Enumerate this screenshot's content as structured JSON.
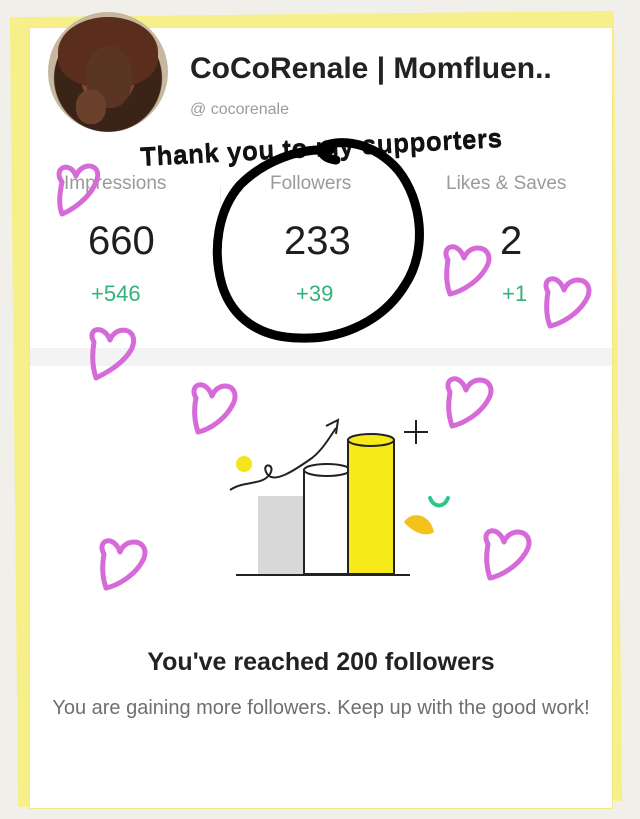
{
  "profile": {
    "name": "CoCoRenale | Momfluen..",
    "handle": "@ cocorenale"
  },
  "annotation": {
    "thanks": "Thank you to my supporters"
  },
  "stats": [
    {
      "label": "Impressions",
      "value": "660",
      "delta": "+546"
    },
    {
      "label": "Followers",
      "value": "233",
      "delta": "+39"
    },
    {
      "label": "Likes & Saves",
      "value": "2",
      "delta": "+1"
    }
  ],
  "milestone": {
    "title": "You've reached 200 followers",
    "message": "You are gaining more followers. Keep up with the good work!"
  },
  "colors": {
    "delta_green": "#32b27c",
    "frame_yellow": "#f7f08a",
    "heart_pink": "#d56ad8",
    "bar_yellow": "#f7ea1a"
  },
  "icons": [
    "heart-icon",
    "sparkle-icon",
    "growth-arrow-icon"
  ]
}
